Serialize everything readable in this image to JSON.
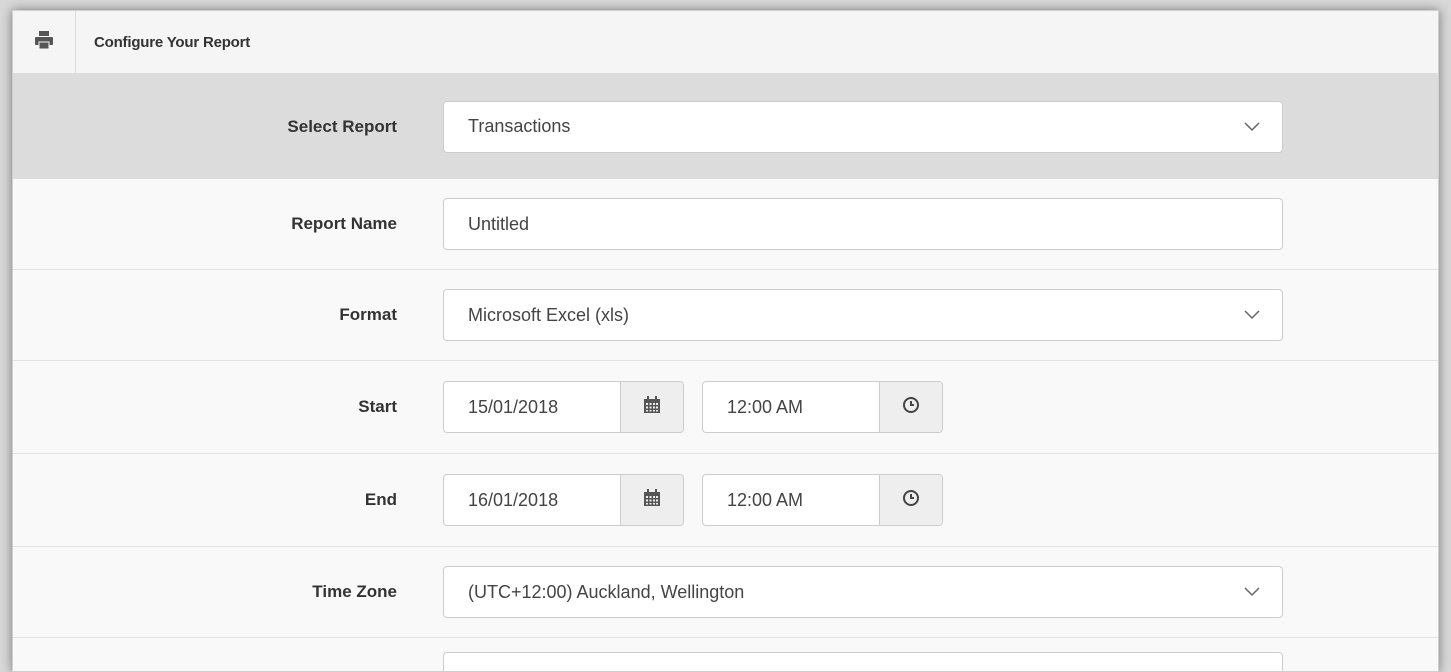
{
  "header": {
    "title": "Configure Your Report",
    "icon": "printer-icon"
  },
  "fields": {
    "select_report": {
      "label": "Select Report",
      "value": "Transactions"
    },
    "report_name": {
      "label": "Report Name",
      "value": "Untitled"
    },
    "format": {
      "label": "Format",
      "value": "Microsoft Excel (xls)"
    },
    "start": {
      "label": "Start",
      "date": "15/01/2018",
      "time": "12:00 AM"
    },
    "end": {
      "label": "End",
      "date": "16/01/2018",
      "time": "12:00 AM"
    },
    "time_zone": {
      "label": "Time Zone",
      "value": "(UTC+12:00) Auckland, Wellington"
    }
  },
  "colors": {
    "highlight_row": "#dcdcdc",
    "panel_bg": "#f9f9f9",
    "addon_bg": "#eeeeee"
  }
}
